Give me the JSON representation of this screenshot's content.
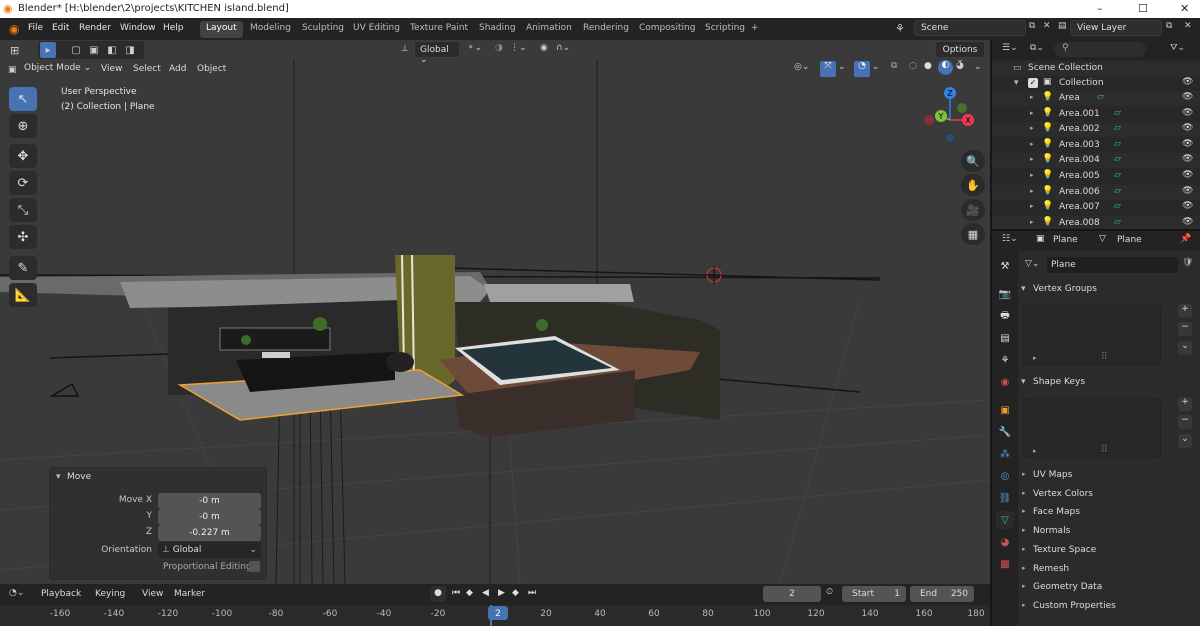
{
  "window": {
    "title": "Blender* [H:\\blender\\2\\projects\\KITCHEN island.blend]",
    "minimize": "–",
    "maximize": "☐",
    "close": "✕"
  },
  "menu": [
    "File",
    "Edit",
    "Render",
    "Window",
    "Help"
  ],
  "workspaces": [
    "Layout",
    "Modeling",
    "Sculpting",
    "UV Editing",
    "Texture Paint",
    "Shading",
    "Animation",
    "Rendering",
    "Compositing",
    "Scripting",
    "+"
  ],
  "scene": {
    "name": "Scene",
    "view_layer": "View Layer"
  },
  "viewport": {
    "transform_orientation": "Global",
    "options_label": "Options",
    "mode": "Object Mode",
    "header_menus": [
      "View",
      "Select",
      "Add",
      "Object"
    ],
    "info_line1": "User Perspective",
    "info_line2": "(2) Collection | Plane",
    "gizmo": {
      "z": "Z",
      "y": "Y",
      "x": "X"
    }
  },
  "operator_panel": {
    "title": "Move",
    "fields": [
      {
        "label": "Move X",
        "value": "-0 m"
      },
      {
        "label": "Y",
        "value": "-0 m"
      },
      {
        "label": "Z",
        "value": "-0.227 m"
      }
    ],
    "orientation_label": "Orientation",
    "orientation_value": "Global",
    "proportional_label": "Proportional Editing"
  },
  "timeline": {
    "menus": [
      "Playback",
      "Keying",
      "View",
      "Marker"
    ],
    "current_frame": "2",
    "start_label": "Start",
    "start_value": "1",
    "end_label": "End",
    "end_value": "250",
    "ticks": [
      "-160",
      "-140",
      "-120",
      "-100",
      "-80",
      "-60",
      "-40",
      "-20",
      "2",
      "20",
      "40",
      "60",
      "80",
      "100",
      "120",
      "140",
      "160",
      "180"
    ]
  },
  "outliner": {
    "scene_collection": "Scene Collection",
    "collection": "Collection",
    "items": [
      "Area",
      "Area.001",
      "Area.002",
      "Area.003",
      "Area.004",
      "Area.005",
      "Area.006",
      "Area.007",
      "Area.008"
    ]
  },
  "properties": {
    "object_name": "Plane",
    "data_name": "Plane",
    "mesh_name": "Plane",
    "panels_open": [
      "Vertex Groups",
      "Shape Keys"
    ],
    "panels_closed": [
      "UV Maps",
      "Vertex Colors",
      "Face Maps",
      "Normals",
      "Texture Space",
      "Remesh",
      "Geometry Data",
      "Custom Properties"
    ]
  },
  "colors": {
    "accent": "#4772b3",
    "active_object": "#f0a030",
    "gizmo_x": "#ee3b52",
    "gizmo_y": "#82c23a",
    "gizmo_z": "#2f83e6",
    "object_data": "#36c088"
  }
}
